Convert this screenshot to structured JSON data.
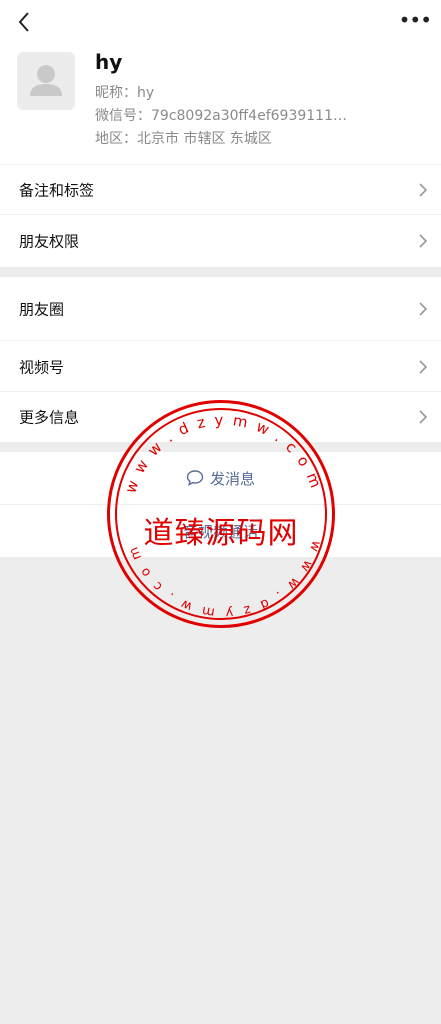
{
  "profile": {
    "display_name": "hy",
    "nickname": "昵称：hy",
    "wechat_id": "微信号：79c8092a30ff4ef6939111…",
    "region": "地区：北京市 市辖区 东城区"
  },
  "menu1": {
    "items": [
      {
        "label": "备注和标签"
      },
      {
        "label": "朋友权限"
      }
    ]
  },
  "menu2": {
    "items": [
      {
        "label": "朋友圈"
      },
      {
        "label": "视频号"
      },
      {
        "label": "更多信息"
      }
    ]
  },
  "actions": {
    "send_message": "发消息",
    "video_call": "音视频通话"
  },
  "watermark": {
    "center_text": "道臻源码网",
    "ring_text": "w w w . d z y m w . c o m",
    "color": "#e00000"
  },
  "colors": {
    "link": "#576b95",
    "background": "#ededed"
  },
  "icons": {
    "back": "chevron-left-icon",
    "more": "more-dots-icon",
    "chat": "chat-bubble-icon",
    "avatar": "default-avatar-icon"
  }
}
